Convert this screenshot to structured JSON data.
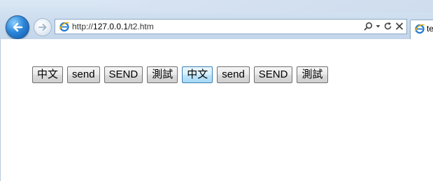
{
  "browser": {
    "address": {
      "scheme": "http://",
      "host": "127.0.0.1",
      "path": "/t2.htm"
    },
    "tab": {
      "label": "te"
    },
    "icons": {
      "back": "back-arrow-icon",
      "forward": "forward-arrow-icon",
      "site": "ie-logo-icon",
      "search": "search-icon",
      "dropdown": "dropdown-arrow-icon",
      "refresh": "refresh-icon",
      "stop": "stop-icon"
    }
  },
  "page": {
    "buttons": [
      {
        "label": "中文",
        "focused": false
      },
      {
        "label": "send",
        "focused": false
      },
      {
        "label": "SEND",
        "focused": false
      },
      {
        "label": "測試",
        "focused": false
      },
      {
        "label": "中文",
        "focused": true
      },
      {
        "label": "send",
        "focused": false
      },
      {
        "label": "SEND",
        "focused": false
      },
      {
        "label": "測試",
        "focused": false
      }
    ]
  },
  "colors": {
    "chrome": "#cbdcee",
    "focus_border": "#3c7fb1",
    "button_border": "#707070"
  }
}
